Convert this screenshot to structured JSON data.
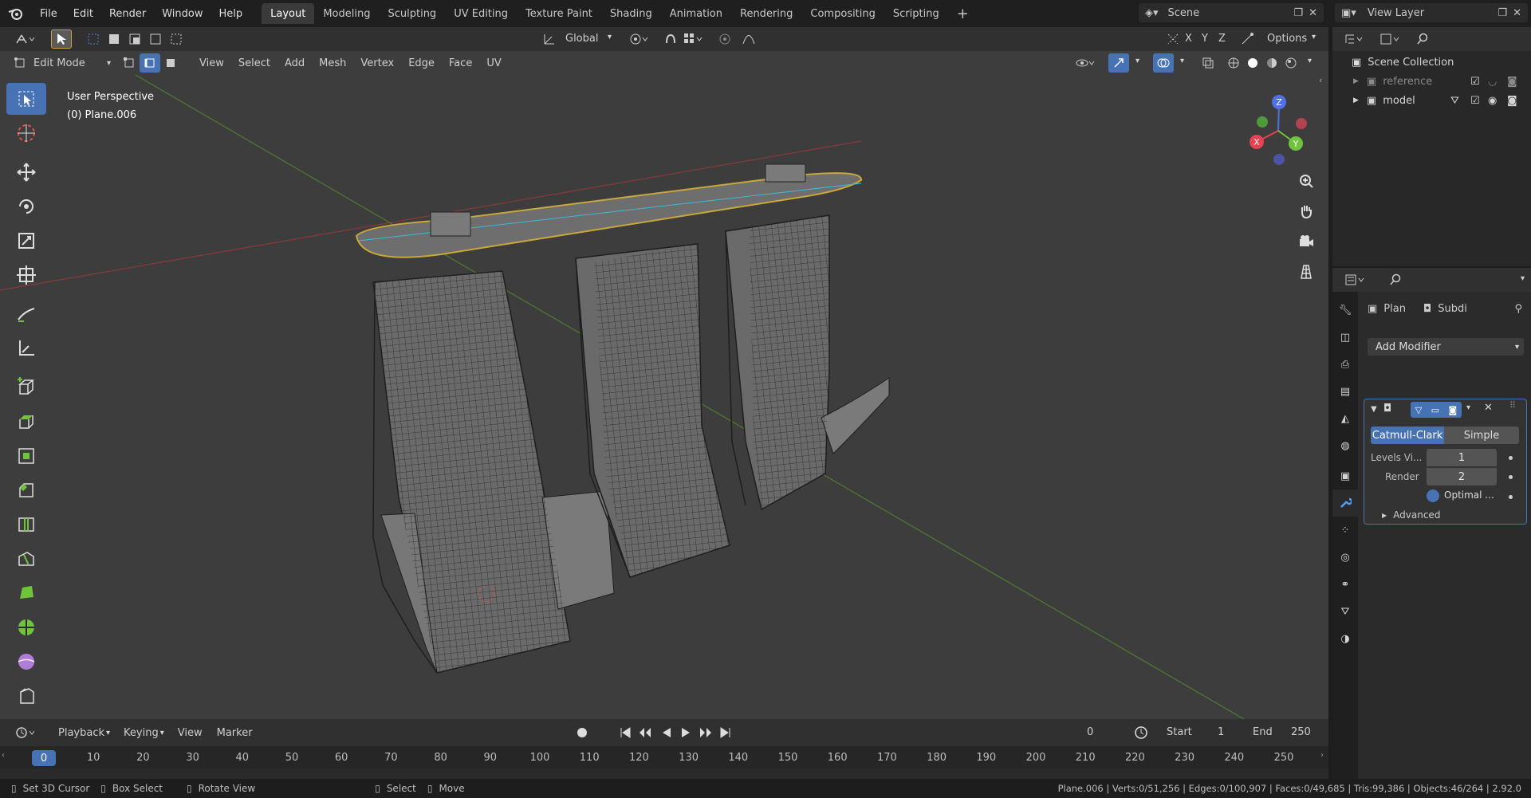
{
  "app": {
    "menus": [
      "File",
      "Edit",
      "Render",
      "Window",
      "Help"
    ],
    "workspaces": [
      "Layout",
      "Modeling",
      "Sculpting",
      "UV Editing",
      "Texture Paint",
      "Shading",
      "Animation",
      "Rendering",
      "Compositing",
      "Scripting"
    ],
    "active_workspace": "Layout",
    "scene": "Scene",
    "view_layer": "View Layer"
  },
  "viewport": {
    "transform_orientation": "Global",
    "mode": "Edit Mode",
    "menus": [
      "View",
      "Select",
      "Add",
      "Mesh",
      "Vertex",
      "Edge",
      "Face",
      "UV"
    ],
    "axes": [
      "X",
      "Y",
      "Z"
    ],
    "options_label": "Options",
    "overlay_title": "User Perspective",
    "overlay_object": "(0) Plane.006",
    "gizmo": {
      "z": "Z",
      "x": "X",
      "y": "Y"
    }
  },
  "timeline": {
    "menus": [
      "Playback",
      "Keying",
      "View",
      "Marker"
    ],
    "current_frame": "0",
    "start_label": "Start",
    "start": "1",
    "end_label": "End",
    "end": "250",
    "ruler": [
      "0",
      "10",
      "20",
      "30",
      "40",
      "50",
      "60",
      "70",
      "80",
      "90",
      "100",
      "110",
      "120",
      "130",
      "140",
      "150",
      "160",
      "170",
      "180",
      "190",
      "200",
      "210",
      "220",
      "230",
      "240",
      "250"
    ]
  },
  "statusbar": {
    "hints": [
      "Set 3D Cursor",
      "Box Select",
      "Rotate View",
      "Select",
      "Move"
    ],
    "stats": "Plane.006 | Verts:0/51,256 | Edges:0/100,907 | Faces:0/49,685 | Tris:99,386 | Objects:46/264 | 2.92.0"
  },
  "outliner": {
    "root": "Scene Collection",
    "items": [
      "reference",
      "model"
    ]
  },
  "properties": {
    "breadcrumb": [
      "Plan",
      "Subdi"
    ],
    "add_modifier": "Add Modifier",
    "modifier": {
      "types": [
        "Catmull-Clark",
        "Simple"
      ],
      "levels_label": "Levels Vi...",
      "levels_value": "1",
      "render_label": "Render",
      "render_value": "2",
      "optimal_label": "Optimal ...",
      "advanced_label": "Advanced"
    }
  },
  "colors": {
    "accent": "#4772b3",
    "x_axis": "#e84152",
    "y_axis": "#6fc43c",
    "z_axis": "#4f71e4"
  }
}
